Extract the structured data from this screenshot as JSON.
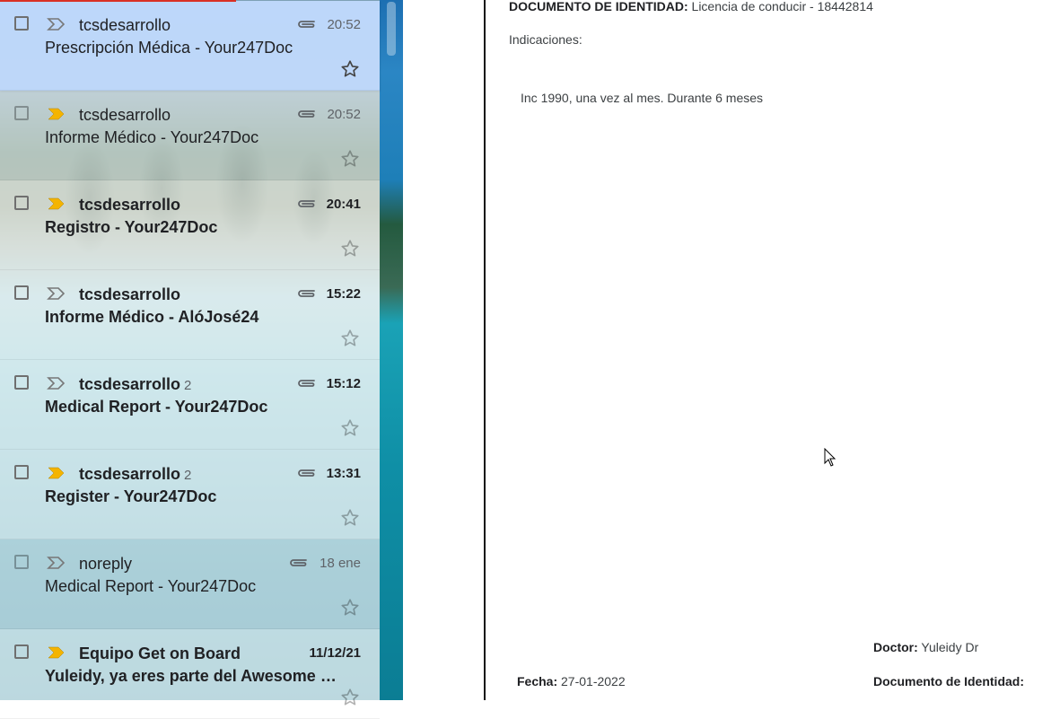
{
  "mail_list": [
    {
      "sender": "tcsdesarrollo",
      "count": "",
      "time": "20:52",
      "subject": "Prescripción Médica - Your247Doc",
      "unread": false,
      "selected": true,
      "importance_icon": "important-marker-outline-icon",
      "attachment": true
    },
    {
      "sender": "tcsdesarrollo",
      "count": "",
      "time": "20:52",
      "subject": "Informe Médico - Your247Doc",
      "unread": false,
      "selected": false,
      "importance_icon": "important-marker-yellow-icon",
      "attachment": true
    },
    {
      "sender": "tcsdesarrollo",
      "count": "",
      "time": "20:41",
      "subject": "Registro - Your247Doc",
      "unread": true,
      "selected": false,
      "importance_icon": "important-marker-yellow-icon",
      "attachment": true
    },
    {
      "sender": "tcsdesarrollo",
      "count": "",
      "time": "15:22",
      "subject": "Informe Médico - AlóJosé24",
      "unread": true,
      "selected": false,
      "importance_icon": "important-marker-outline-icon",
      "attachment": true
    },
    {
      "sender": "tcsdesarrollo",
      "count": "2",
      "time": "15:12",
      "subject": "Medical Report - Your247Doc",
      "unread": true,
      "selected": false,
      "importance_icon": "important-marker-outline-icon",
      "attachment": true
    },
    {
      "sender": "tcsdesarrollo",
      "count": "2",
      "time": "13:31",
      "subject": "Register - Your247Doc",
      "unread": true,
      "selected": false,
      "importance_icon": "important-marker-yellow-icon",
      "attachment": true
    },
    {
      "sender": "noreply",
      "count": "",
      "time": "18 ene",
      "subject": "Medical Report - Your247Doc",
      "unread": false,
      "selected": false,
      "importance_icon": "important-marker-outline-icon",
      "attachment": true
    },
    {
      "sender": "Equipo Get on Board",
      "count": "",
      "time": "11/12/21",
      "subject": "Yuleidy, ya eres parte del Awesome F...",
      "unread": true,
      "selected": false,
      "importance_icon": "important-marker-yellow-icon",
      "attachment": false
    }
  ],
  "document": {
    "id_label": "DOCUMENTO DE IDENTIDAD:",
    "id_value": "Licencia de conducir - 18442814",
    "indications_label": "Indicaciones:",
    "indications_text": "Inc 1990, una vez al mes. Durante 6 meses",
    "doctor_label": "Doctor:",
    "doctor_value": "Yuleidy Dr",
    "date_label": "Fecha:",
    "date_value": "27-01-2022",
    "doctor_id_label": "Documento de Identidad:"
  },
  "colors": {
    "important_yellow": "#f4b400",
    "selected_row": "#c2dbff",
    "accent_red": "#d93025"
  }
}
